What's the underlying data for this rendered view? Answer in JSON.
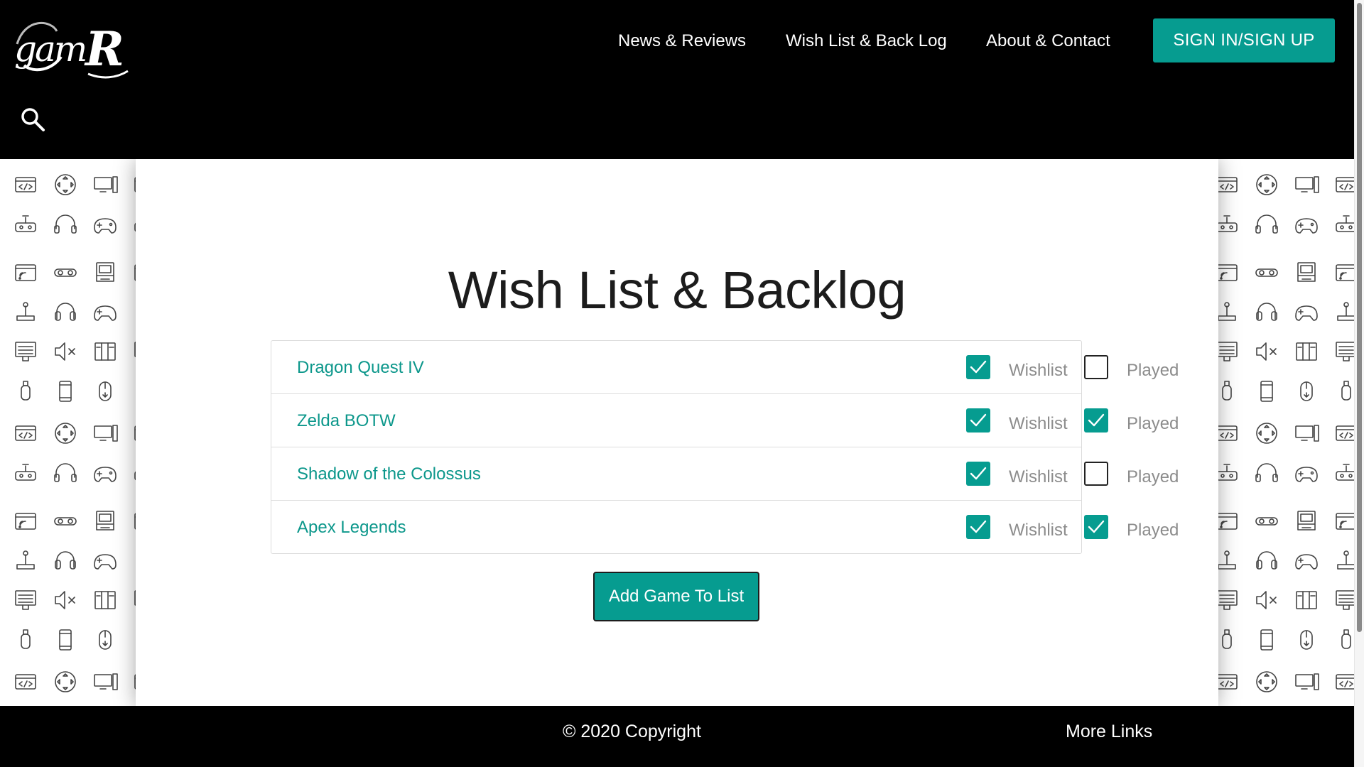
{
  "header": {
    "logo_text": "gamR",
    "nav": [
      {
        "label": "News & Reviews"
      },
      {
        "label": "Wish List & Back Log"
      },
      {
        "label": "About & Contact"
      }
    ],
    "signin_label": "SIGN IN/SIGN UP"
  },
  "main": {
    "title": "Wish List & Backlog",
    "games": [
      {
        "title": "Dragon Quest IV",
        "wishlist": true,
        "played": false
      },
      {
        "title": "Zelda BOTW",
        "wishlist": true,
        "played": true
      },
      {
        "title": "Shadow of the Colossus",
        "wishlist": true,
        "played": false
      },
      {
        "title": "Apex Legends",
        "wishlist": true,
        "played": true
      }
    ],
    "wishlist_label": "Wishlist",
    "played_label": "Played",
    "add_button_label": "Add Game To List"
  },
  "footer": {
    "copyright": "© 2020 Copyright",
    "more_links": "More Links"
  },
  "colors": {
    "accent": "#069c90",
    "link": "#0c978b",
    "header_bg": "#000000"
  },
  "icons": {
    "search": "search-icon",
    "checkbox_checked": "checkmark-icon"
  }
}
